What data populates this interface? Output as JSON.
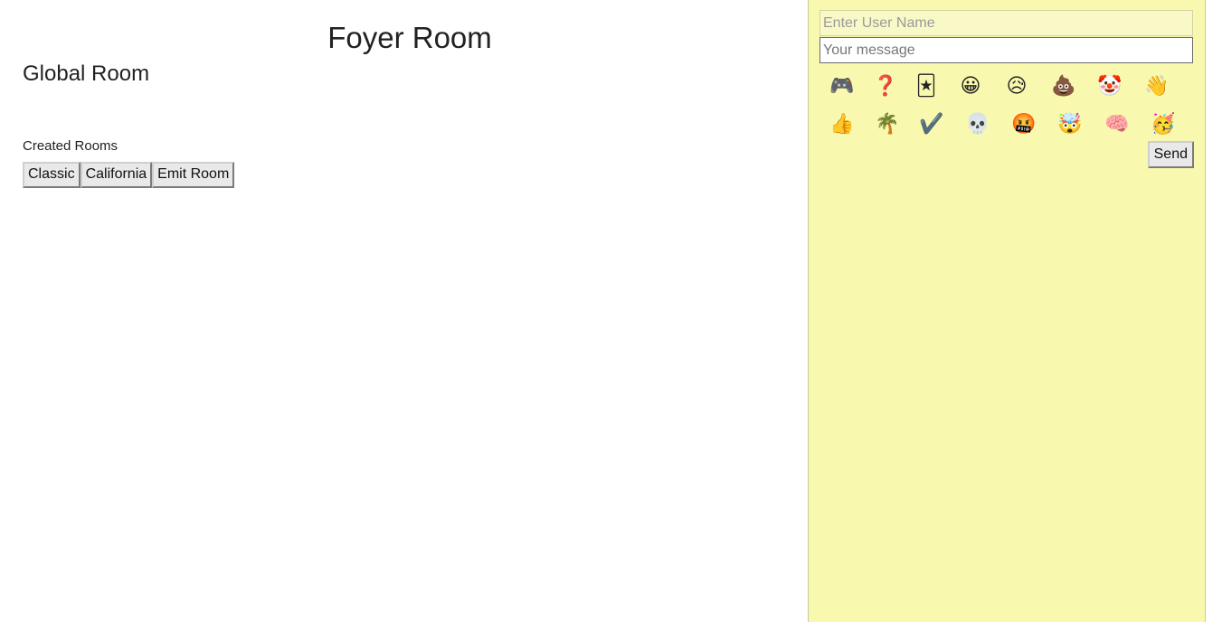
{
  "main": {
    "title": "Foyer Room",
    "global_room_title": "Global Room",
    "created_rooms_label": "Created Rooms",
    "rooms": [
      {
        "label": "Classic"
      },
      {
        "label": "California"
      },
      {
        "label": "Emit Room"
      }
    ]
  },
  "chat": {
    "background_color": "#f8f9ae",
    "username": {
      "value": "",
      "placeholder": "Enter User Name"
    },
    "message": {
      "value": "",
      "placeholder": "Your message"
    },
    "emojis": [
      [
        "🎮",
        "❓",
        "🃏",
        "😀",
        "😥",
        "💩",
        "🤡",
        "👋"
      ],
      [
        "👍",
        "🌴",
        "✔️",
        "💀",
        "🤬",
        "🤯",
        "🧠",
        "🥳"
      ]
    ],
    "send_label": "Send"
  }
}
